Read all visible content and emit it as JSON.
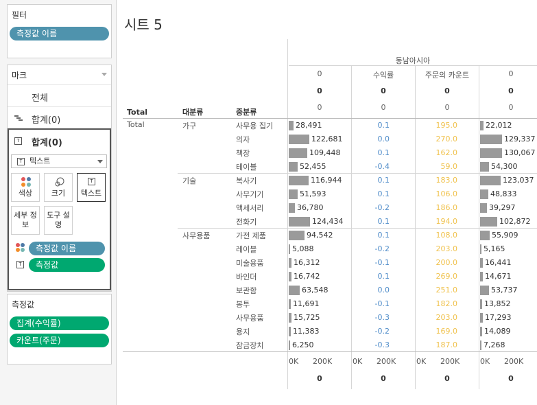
{
  "left_panel": {
    "filters": {
      "title": "필터",
      "pill": "측정값 이름"
    },
    "marks": {
      "title": "마크",
      "all_label": "전체",
      "sum_label": "합계(0)",
      "active_label": "합계(0)",
      "mark_type": "텍스트",
      "tiles": {
        "color": "색상",
        "size": "크기",
        "text": "텍스트",
        "detail": "세부 정보",
        "tooltip": "도구 설명"
      },
      "pills": {
        "color_pill": "측정값 이름",
        "text_pill": "측정값"
      }
    },
    "measures": {
      "title": "측정값",
      "pills": [
        "집계(수익률)",
        "카운트(주문)"
      ]
    }
  },
  "sheet": {
    "title": "시트 5",
    "region_header": "동남아시아",
    "column_headers": {
      "col1": "0",
      "col2": "수익률",
      "col3": "주문의 카운트",
      "col4": "0"
    },
    "zero": "0",
    "row_headers": {
      "total": "Total",
      "category": "대분류",
      "subcategory": "중분류"
    },
    "total_label": "Total",
    "axis_ticks": [
      "0K",
      "200K"
    ],
    "colors": {
      "bar": "#9a9a9a",
      "profit": "#4f8cc9",
      "count": "#f0c24d",
      "pill_blue": "#4f93ad",
      "pill_green": "#00a870"
    }
  },
  "table": {
    "groups": [
      {
        "name": "가구",
        "rows": [
          {
            "sub": "사무용 집기",
            "v1": 28491,
            "v1_label": "28,491",
            "profit": "0.1",
            "count": "195.0",
            "v4": 22012,
            "v4_label": "22,012"
          },
          {
            "sub": "의자",
            "v1": 122681,
            "v1_label": "122,681",
            "profit": "0.0",
            "count": "270.0",
            "v4": 129337,
            "v4_label": "129,337"
          },
          {
            "sub": "책장",
            "v1": 109448,
            "v1_label": "109,448",
            "profit": "0.1",
            "count": "162.0",
            "v4": 130067,
            "v4_label": "130,067"
          },
          {
            "sub": "테이블",
            "v1": 52455,
            "v1_label": "52,455",
            "profit": "-0.4",
            "count": "59.0",
            "v4": 54300,
            "v4_label": "54,300"
          }
        ]
      },
      {
        "name": "기술",
        "rows": [
          {
            "sub": "복사기",
            "v1": 116944,
            "v1_label": "116,944",
            "profit": "0.1",
            "count": "183.0",
            "v4": 123037,
            "v4_label": "123,037"
          },
          {
            "sub": "사무기기",
            "v1": 51593,
            "v1_label": "51,593",
            "profit": "0.1",
            "count": "106.0",
            "v4": 48833,
            "v4_label": "48,833"
          },
          {
            "sub": "액세서리",
            "v1": 36780,
            "v1_label": "36,780",
            "profit": "-0.2",
            "count": "186.0",
            "v4": 39297,
            "v4_label": "39,297"
          },
          {
            "sub": "전화기",
            "v1": 124434,
            "v1_label": "124,434",
            "profit": "0.1",
            "count": "194.0",
            "v4": 102872,
            "v4_label": "102,872"
          }
        ]
      },
      {
        "name": "사무용품",
        "rows": [
          {
            "sub": "가전 제품",
            "v1": 94542,
            "v1_label": "94,542",
            "profit": "0.1",
            "count": "108.0",
            "v4": 55909,
            "v4_label": "55,909"
          },
          {
            "sub": "레이블",
            "v1": 5088,
            "v1_label": "5,088",
            "profit": "-0.2",
            "count": "203.0",
            "v4": 5165,
            "v4_label": "5,165"
          },
          {
            "sub": "미술용품",
            "v1": 16312,
            "v1_label": "16,312",
            "profit": "-0.1",
            "count": "200.0",
            "v4": 16441,
            "v4_label": "16,441"
          },
          {
            "sub": "바인더",
            "v1": 16742,
            "v1_label": "16,742",
            "profit": "0.1",
            "count": "269.0",
            "v4": 14671,
            "v4_label": "14,671"
          },
          {
            "sub": "보관함",
            "v1": 63548,
            "v1_label": "63,548",
            "profit": "0.0",
            "count": "251.0",
            "v4": 53737,
            "v4_label": "53,737"
          },
          {
            "sub": "봉투",
            "v1": 11691,
            "v1_label": "11,691",
            "profit": "-0.1",
            "count": "182.0",
            "v4": 13852,
            "v4_label": "13,852"
          },
          {
            "sub": "사무용품",
            "v1": 15725,
            "v1_label": "15,725",
            "profit": "-0.3",
            "count": "203.0",
            "v4": 17293,
            "v4_label": "17,293"
          },
          {
            "sub": "용지",
            "v1": 11383,
            "v1_label": "11,383",
            "profit": "-0.2",
            "count": "169.0",
            "v4": 14089,
            "v4_label": "14,089"
          },
          {
            "sub": "잠금장치",
            "v1": 6250,
            "v1_label": "6,250",
            "profit": "-0.3",
            "count": "187.0",
            "v4": 7268,
            "v4_label": "7,268"
          }
        ]
      }
    ]
  }
}
